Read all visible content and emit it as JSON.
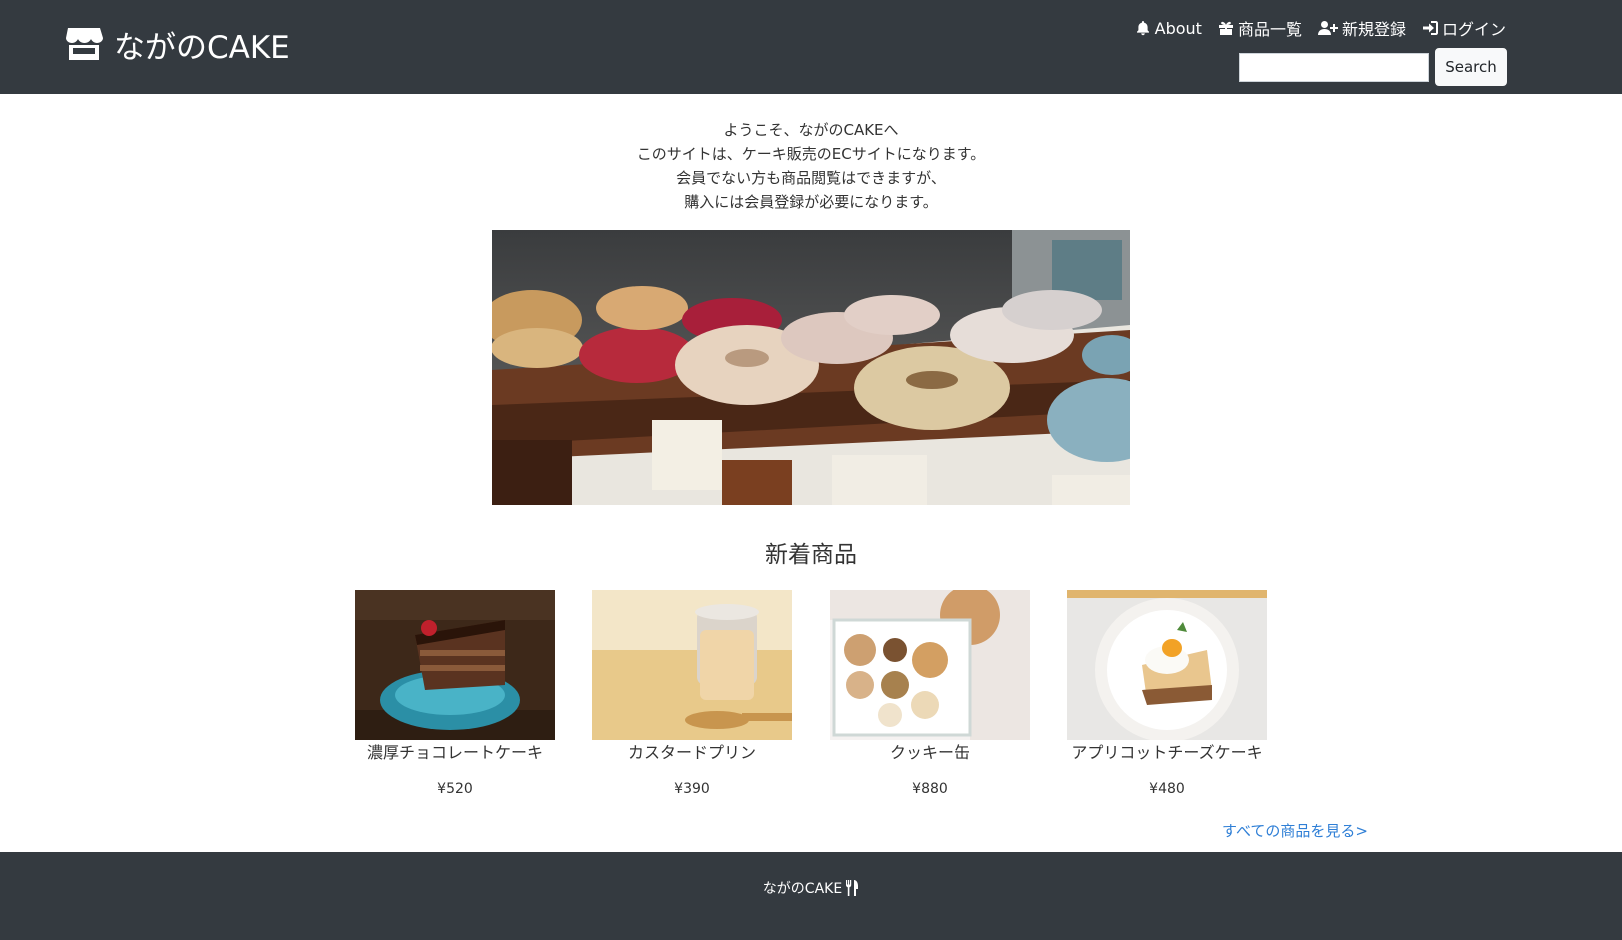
{
  "header": {
    "brand": "ながのCAKE",
    "brand_icon": "store-icon",
    "nav": [
      {
        "label": "About",
        "icon": "bell-icon"
      },
      {
        "label": "商品一覧",
        "icon": "gift-icon"
      },
      {
        "label": "新規登録",
        "icon": "user-plus-icon"
      },
      {
        "label": "ログイン",
        "icon": "sign-in-icon"
      }
    ],
    "search": {
      "value": "",
      "placeholder": "",
      "button_label": "Search"
    }
  },
  "welcome": {
    "lines": [
      "ようこそ、ながのCAKEへ",
      "このサイトは、ケーキ販売のECサイトになります。",
      "会員でない方も商品閲覧はできますが、",
      "購入には会員登録が必要になります。"
    ]
  },
  "new_products": {
    "title": "新着商品",
    "items": [
      {
        "name": "濃厚チョコレートケーキ",
        "price": "¥520"
      },
      {
        "name": "カスタードプリン",
        "price": "¥390"
      },
      {
        "name": "クッキー缶",
        "price": "¥880"
      },
      {
        "name": "アプリコットチーズケーキ",
        "price": "¥480"
      }
    ],
    "see_all": "すべての商品を見る>"
  },
  "footer": {
    "text": "ながのCAKE",
    "icon": "utensils-icon"
  },
  "colors": {
    "navbar": "#343a40",
    "link": "#2f7fd6",
    "background": "#ffffff"
  }
}
